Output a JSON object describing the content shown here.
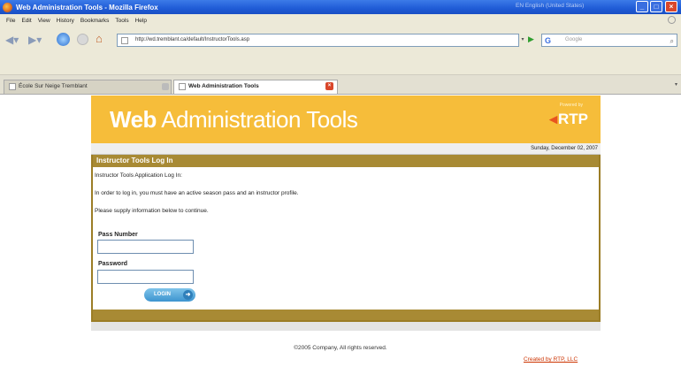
{
  "window": {
    "title": "Web Administration Tools - Mozilla Firefox",
    "language_indicator": "EN English (United States)"
  },
  "menu": [
    "File",
    "Edit",
    "View",
    "History",
    "Bookmarks",
    "Tools",
    "Help"
  ],
  "navigation": {
    "url": "http://wd.tremblant.ca/default/InstructorTools.asp",
    "search_placeholder": "Google"
  },
  "tabs": [
    {
      "label": "École Sur Neige Tremblant"
    },
    {
      "label": "Web Administration Tools"
    }
  ],
  "banner": {
    "title_bold": "Web",
    "title_rest": " Administration Tools",
    "powered_by": "Powered by",
    "logo": "RTP"
  },
  "date": "Sunday, December 02, 2007",
  "login": {
    "header": "Instructor Tools Log In",
    "intro": "Instructor Tools Application Log In:",
    "requirement": "In order to log in, you must have an active season pass and an instructor profile.",
    "instruction": "Please supply information below to continue.",
    "pass_label": "Pass Number",
    "pass_value": "",
    "password_label": "Password",
    "password_value": "",
    "button": "LOGIN"
  },
  "footer": {
    "copyright": "©2005 Company, All rights reserved.",
    "created_by": "Created by RTP, LLC"
  }
}
